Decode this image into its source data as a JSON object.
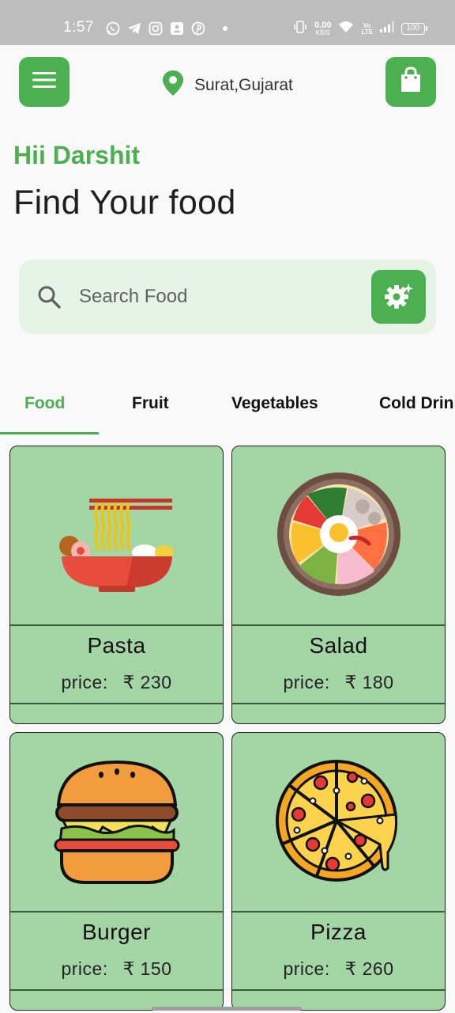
{
  "status_bar": {
    "time": "1:57",
    "net_speed": "0.00",
    "net_unit": "KB/S",
    "volte_top": "Vo",
    "volte_bottom": "LTE",
    "battery": "100",
    "app_icons": [
      "whatsapp-icon",
      "telegram-icon",
      "instagram-icon",
      "photo-app-icon",
      "pinterest-icon"
    ]
  },
  "header": {
    "menu_icon": "hamburger-menu-icon",
    "location_icon": "map-pin-icon",
    "location": "Surat,Gujarat",
    "cart_icon": "shopping-bag-icon"
  },
  "greeting": "Hii Darshit",
  "headline": "Find Your food",
  "search": {
    "placeholder": "Search Food",
    "search_icon": "search-icon",
    "filter_icon": "settings-sparkle-icon"
  },
  "tabs": [
    {
      "label": "Food",
      "active": true
    },
    {
      "label": "Fruit",
      "active": false
    },
    {
      "label": "Vegetables",
      "active": false
    },
    {
      "label": "Cold Drinks",
      "active": false
    }
  ],
  "items": [
    {
      "name": "Pasta",
      "price_label": "price:",
      "currency": "₹",
      "price": "230",
      "icon": "noodle-bowl-icon"
    },
    {
      "name": "Salad",
      "price_label": "price:",
      "currency": "₹",
      "price": "180",
      "icon": "salad-bowl-icon"
    },
    {
      "name": "Burger",
      "price_label": "price:",
      "currency": "₹",
      "price": "150",
      "icon": "burger-icon"
    },
    {
      "name": "Pizza",
      "price_label": "price:",
      "currency": "₹",
      "price": "260",
      "icon": "pizza-icon"
    }
  ],
  "colors": {
    "accent": "#4caf50",
    "card_bg": "#a4d5a5",
    "search_bg": "#e6f4e5",
    "status_bar": "#bdbdbd"
  }
}
